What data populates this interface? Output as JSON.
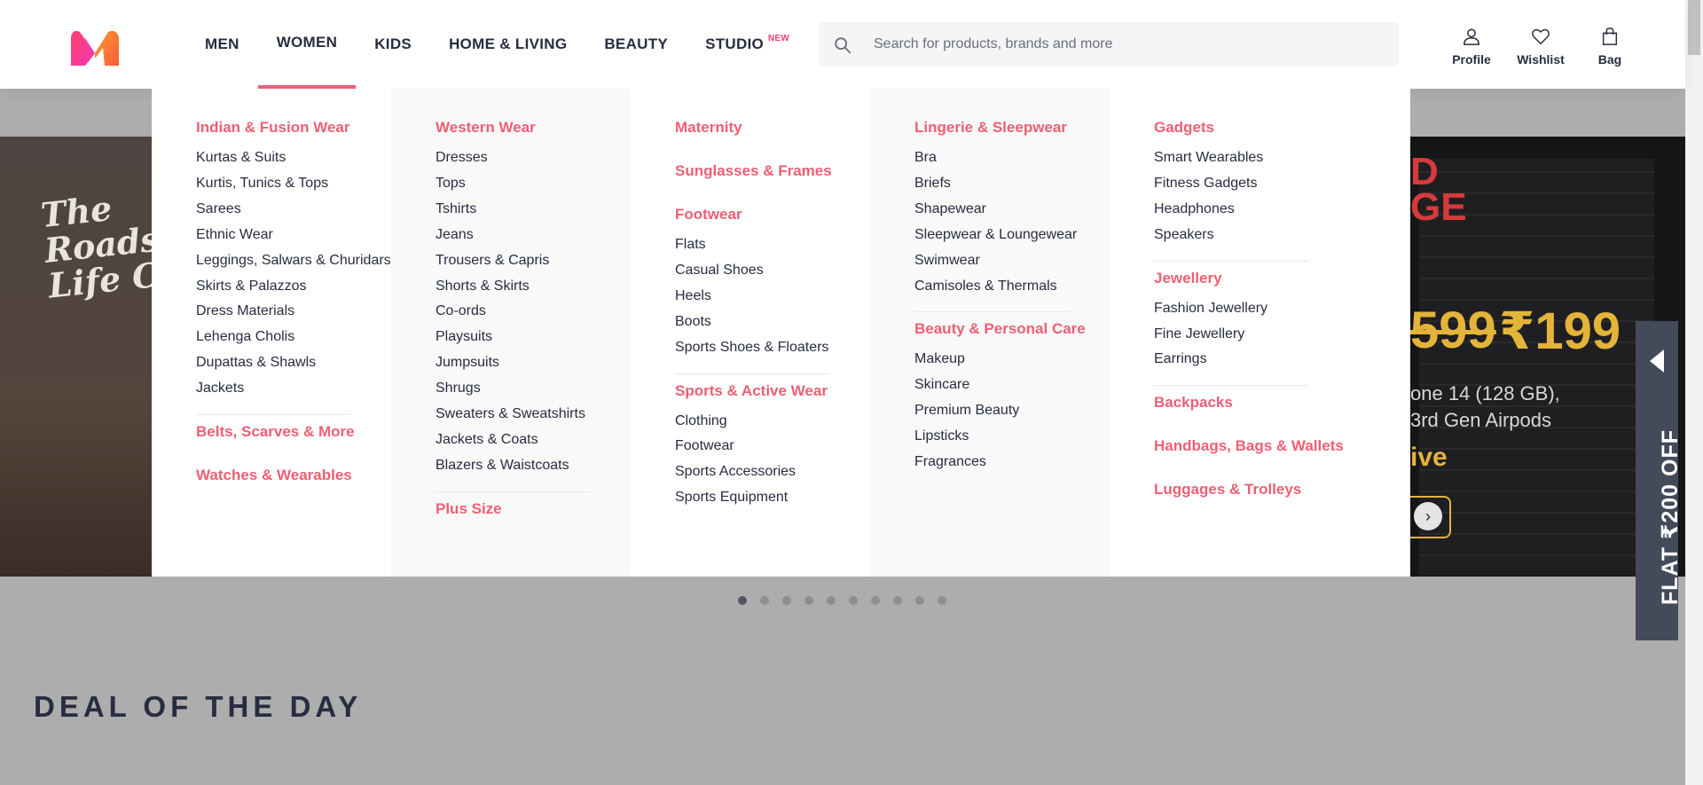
{
  "header": {
    "nav": [
      {
        "label": "Men"
      },
      {
        "label": "Women"
      },
      {
        "label": "Kids"
      },
      {
        "label": "Home & Living"
      },
      {
        "label": "Beauty"
      },
      {
        "label": "Studio",
        "badge": "NEW"
      }
    ],
    "search_placeholder": "Search for products, brands and more",
    "actions": {
      "profile": "Profile",
      "wishlist": "Wishlist",
      "bag": "Bag"
    }
  },
  "mega_menu": {
    "col1": {
      "head1": "Indian & Fusion Wear",
      "items1": [
        "Kurtas & Suits",
        "Kurtis, Tunics & Tops",
        "Sarees",
        "Ethnic Wear",
        "Leggings, Salwars & Churidars",
        "Skirts & Palazzos",
        "Dress Materials",
        "Lehenga Cholis",
        "Dupattas & Shawls",
        "Jackets"
      ],
      "head2": "Belts, Scarves & More",
      "head3": "Watches & Wearables"
    },
    "col2": {
      "head1": "Western Wear",
      "items1": [
        "Dresses",
        "Tops",
        "Tshirts",
        "Jeans",
        "Trousers & Capris",
        "Shorts & Skirts",
        "Co-ords",
        "Playsuits",
        "Jumpsuits",
        "Shrugs",
        "Sweaters & Sweatshirts",
        "Jackets & Coats",
        "Blazers & Waistcoats"
      ],
      "head2": "Plus Size"
    },
    "col3": {
      "head1": "Maternity",
      "head2": "Sunglasses & Frames",
      "head3": "Footwear",
      "items3": [
        "Flats",
        "Casual Shoes",
        "Heels",
        "Boots",
        "Sports Shoes & Floaters"
      ],
      "head4": "Sports & Active Wear",
      "items4": [
        "Clothing",
        "Footwear",
        "Sports Accessories",
        "Sports Equipment"
      ]
    },
    "col4": {
      "head1": "Lingerie & Sleepwear",
      "items1": [
        "Bra",
        "Briefs",
        "Shapewear",
        "Sleepwear & Loungewear",
        "Swimwear",
        "Camisoles & Thermals"
      ],
      "head2": "Beauty & Personal Care",
      "items2": [
        "Makeup",
        "Skincare",
        "Premium Beauty",
        "Lipsticks",
        "Fragrances"
      ]
    },
    "col5": {
      "head1": "Gadgets",
      "items1": [
        "Smart Wearables",
        "Fitness Gadgets",
        "Headphones",
        "Speakers"
      ],
      "head2": "Jewellery",
      "items2": [
        "Fashion Jewellery",
        "Fine Jewellery",
        "Earrings"
      ],
      "head3": "Backpacks",
      "head4": "Handbags, Bags & Wallets",
      "head5": "Luggages & Trolleys"
    }
  },
  "banner": {
    "left_brand": "The Roadste Life Co",
    "right_tag": "D\nGE",
    "price_old": "599",
    "price_new": "₹199",
    "line1": "one 14 (128 GB),",
    "line2": "3rd Gen Airpods",
    "live": "ive"
  },
  "deal_title": "Deal of the Day",
  "flat_offer": "FLAT ₹200 OFF",
  "carousel_dots": 10,
  "colors": {
    "accent": "#ee5f73",
    "brand_pink": "#ff3f6c",
    "text": "#282c3f"
  }
}
